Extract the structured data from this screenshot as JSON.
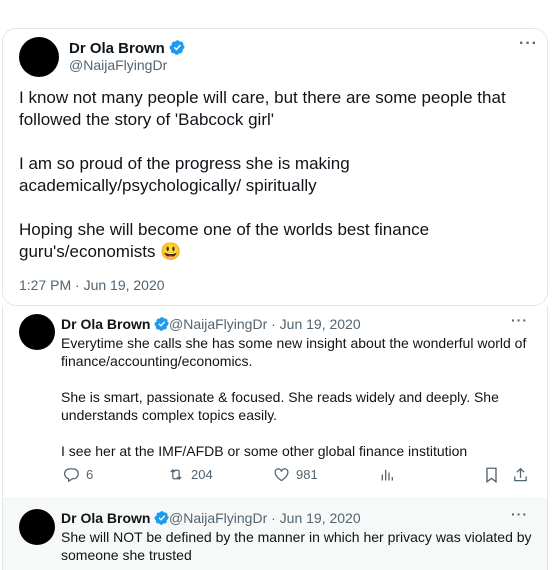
{
  "main_tweet": {
    "name": "Dr Ola Brown",
    "handle": "@NaijaFlyingDr",
    "paragraphs": [
      "I know not many people will care, but there are some people that followed the story of 'Babcock girl'",
      "I am so proud of the progress she is making academically/psychologically/ spiritually",
      "Hoping she will become one of the worlds best finance guru's/economists 😃"
    ],
    "timestamp": "1:27 PM · Jun 19, 2020"
  },
  "reply1": {
    "name": "Dr Ola Brown",
    "handle_date": "@NaijaFlyingDr · Jun 19, 2020",
    "paragraphs": [
      "Everytime she calls she has some new insight about the wonderful world of finance/accounting/economics.",
      "She is smart, passionate & focused.  She reads widely and deeply. She understands complex topics easily.",
      "I see her at the IMF/AFDB or some other global finance institution"
    ],
    "replies": "6",
    "retweets": "204",
    "likes": "981"
  },
  "reply2": {
    "name": "Dr Ola Brown",
    "handle_date": "@NaijaFlyingDr · Jun 19, 2020",
    "text": "She will NOT be defined by the manner in which her privacy was violated by someone she trusted"
  },
  "icons": {
    "more": "more-dots-icon",
    "verified": "verified-badge-icon",
    "reply": "reply-icon",
    "retweet": "retweet-icon",
    "like": "heart-icon",
    "views": "views-icon",
    "bookmark": "bookmark-icon",
    "share": "share-icon"
  },
  "colors": {
    "verified": "#1d9bf0",
    "muted": "#536471"
  }
}
